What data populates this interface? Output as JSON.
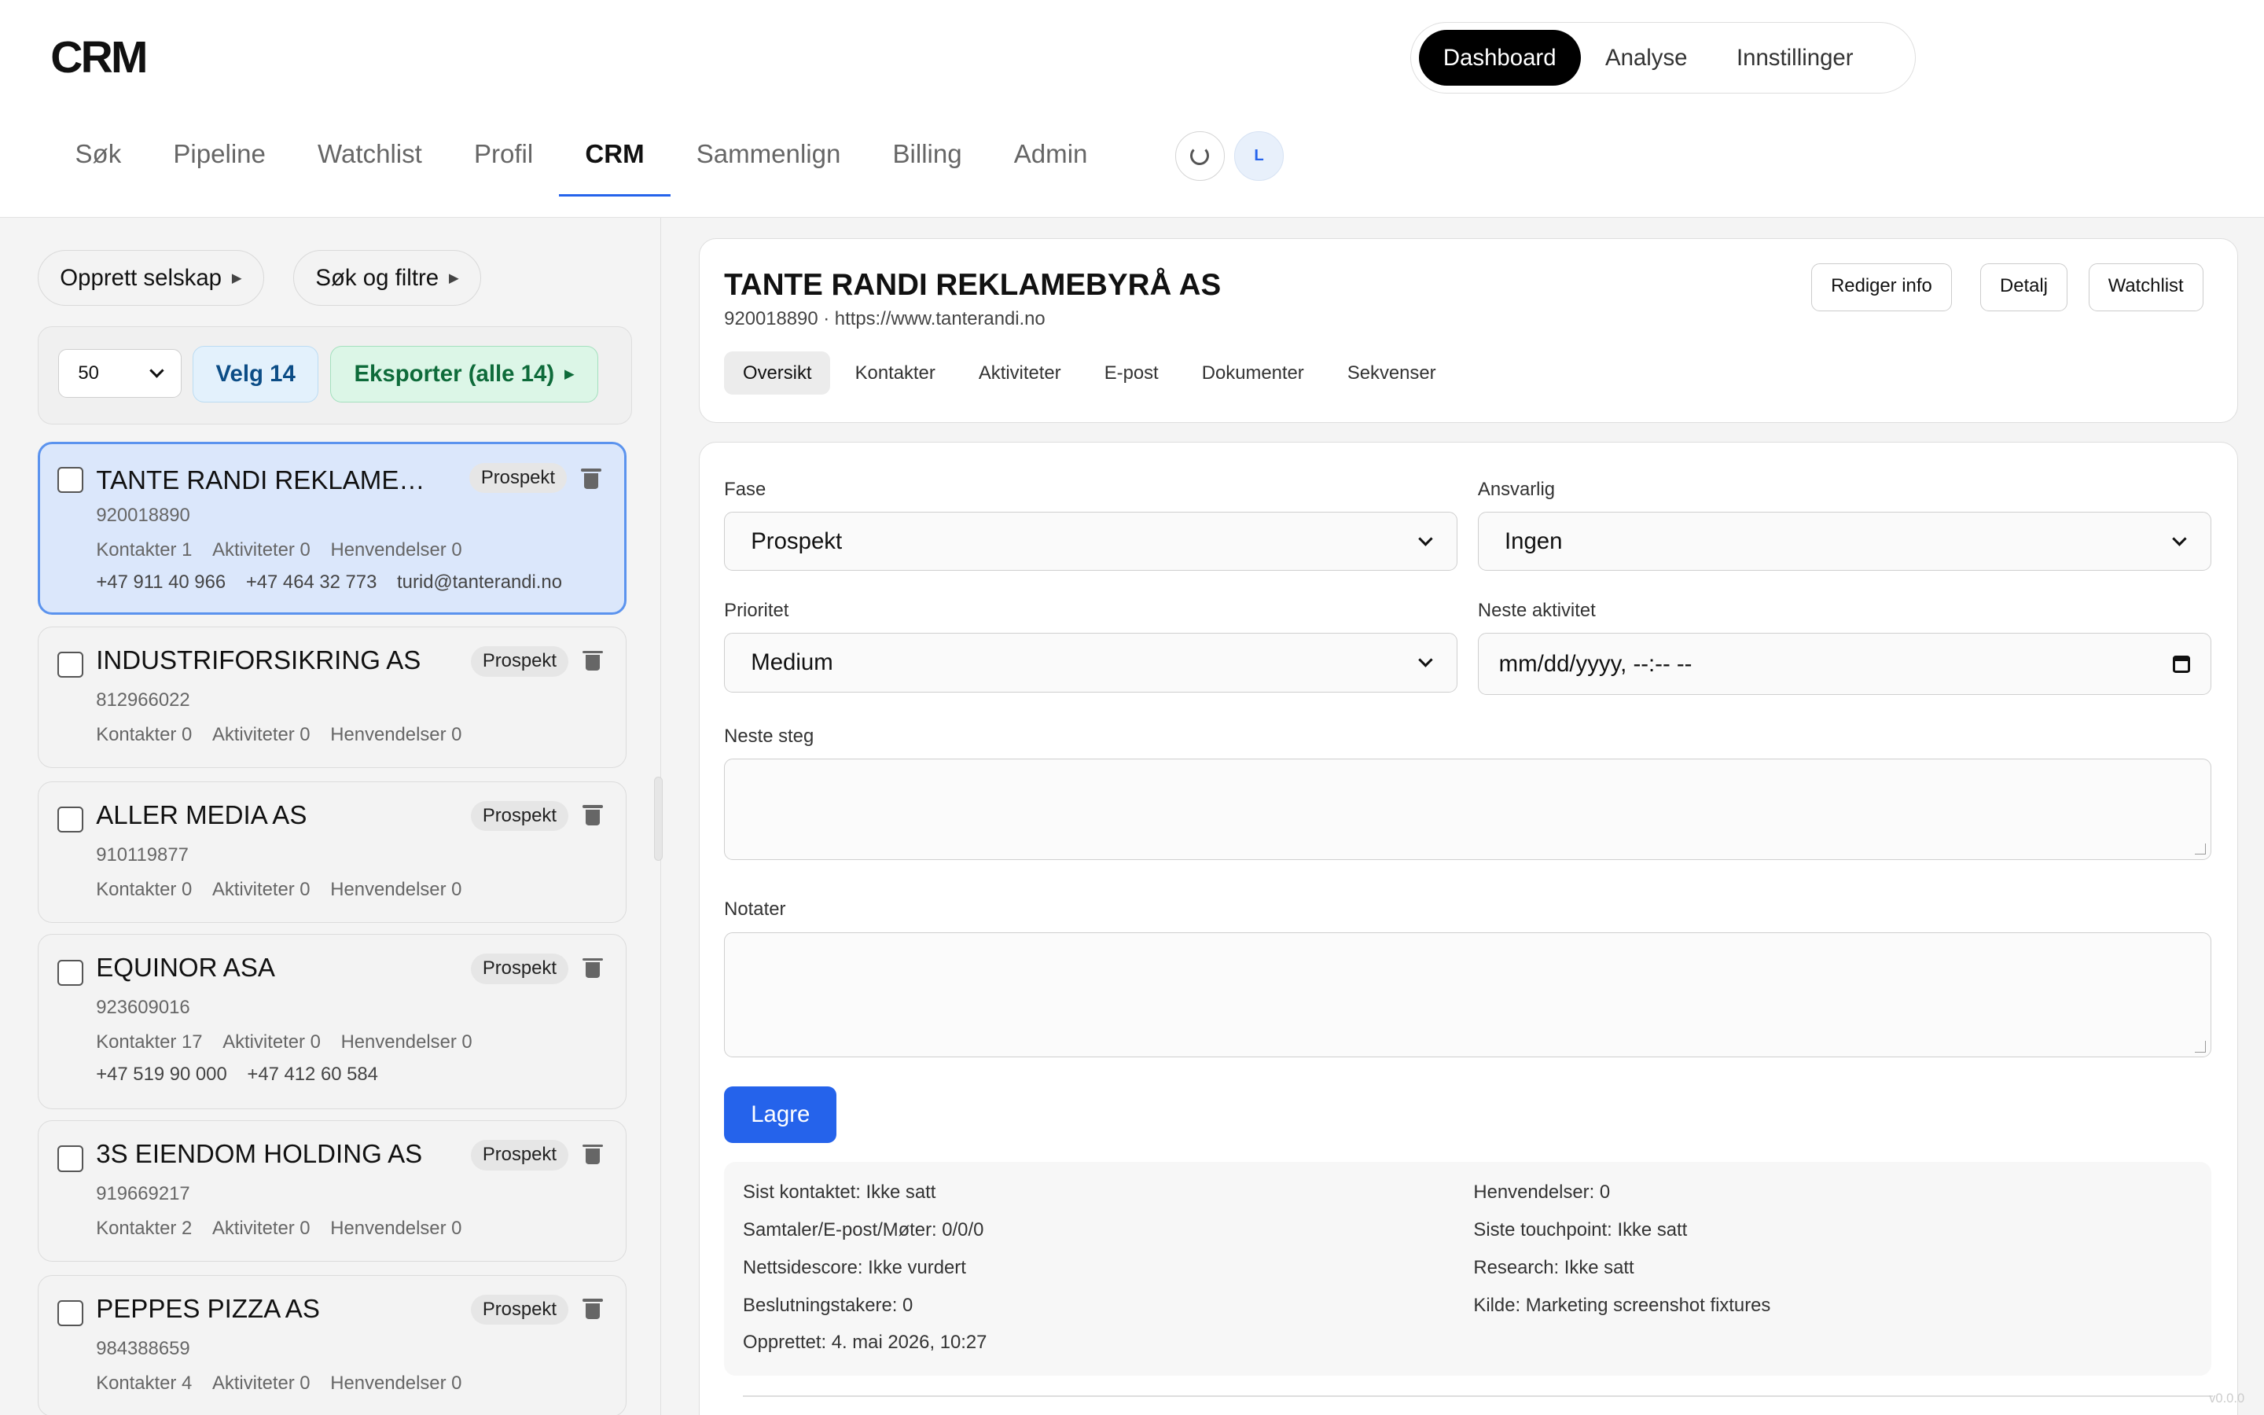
{
  "app": {
    "logo": "CRM"
  },
  "top_segments": [
    "Dashboard",
    "Analyse",
    "Innstillinger"
  ],
  "nav_tabs": [
    "Søk",
    "Pipeline",
    "Watchlist",
    "Profil",
    "CRM",
    "Sammenlign",
    "Billing",
    "Admin"
  ],
  "nav_active": "CRM",
  "avatar_initial": "L",
  "left": {
    "create_label": "Opprett selskap",
    "search_label": "Søk og filtre",
    "page_size": "50",
    "select_label": "Velg 14",
    "export_label": "Eksporter (alle 14)"
  },
  "companies": [
    {
      "name": "TANTE RANDI REKLAMEBYRÅ AS",
      "display_name": "TANTE RANDI REKLAMEB...",
      "orgnr": "920018890",
      "status": "Prospekt",
      "kontakter": "Kontakter 1",
      "aktiviteter": "Aktiviteter 0",
      "henvendelser": "Henvendelser 0",
      "phones": [
        "+47 911 40 966",
        "+47 464 32 773",
        "turid@tanterandi.no"
      ],
      "selected": true
    },
    {
      "name": "INDUSTRIFORSIKRING AS",
      "display_name": "INDUSTRIFORSIKRING AS",
      "orgnr": "812966022",
      "status": "Prospekt",
      "kontakter": "Kontakter 0",
      "aktiviteter": "Aktiviteter 0",
      "henvendelser": "Henvendelser 0",
      "phones": []
    },
    {
      "name": "ALLER MEDIA AS",
      "display_name": "ALLER MEDIA AS",
      "orgnr": "910119877",
      "status": "Prospekt",
      "kontakter": "Kontakter 0",
      "aktiviteter": "Aktiviteter 0",
      "henvendelser": "Henvendelser 0",
      "phones": []
    },
    {
      "name": "EQUINOR ASA",
      "display_name": "EQUINOR ASA",
      "orgnr": "923609016",
      "status": "Prospekt",
      "kontakter": "Kontakter 17",
      "aktiviteter": "Aktiviteter 0",
      "henvendelser": "Henvendelser 0",
      "phones": [
        "+47 519 90 000",
        "+47 412 60 584"
      ]
    },
    {
      "name": "3S EIENDOM HOLDING AS",
      "display_name": "3S EIENDOM HOLDING AS",
      "orgnr": "919669217",
      "status": "Prospekt",
      "kontakter": "Kontakter 2",
      "aktiviteter": "Aktiviteter 0",
      "henvendelser": "Henvendelser 0",
      "phones": []
    },
    {
      "name": "PEPPES PIZZA AS",
      "display_name": "PEPPES PIZZA AS",
      "orgnr": "984388659",
      "status": "Prospekt",
      "kontakter": "Kontakter 4",
      "aktiviteter": "Aktiviteter 0",
      "henvendelser": "Henvendelser 0",
      "phones": []
    }
  ],
  "detail": {
    "title": "TANTE RANDI REKLAMEBYRÅ AS",
    "subtitle": "920018890 · https://www.tanterandi.no",
    "buttons": [
      "Rediger info",
      "Detalj",
      "Watchlist"
    ],
    "tabs": [
      "Oversikt",
      "Kontakter",
      "Aktiviteter",
      "E-post",
      "Dokumenter",
      "Sekvenser"
    ],
    "active_tab": "Oversikt"
  },
  "form": {
    "fase_label": "Fase",
    "fase_value": "Prospekt",
    "ansvarlig_label": "Ansvarlig",
    "ansvarlig_value": "Ingen",
    "prioritet_label": "Prioritet",
    "prioritet_value": "Medium",
    "neste_aktivitet_label": "Neste aktivitet",
    "neste_aktivitet_value": "mm/dd/yyyy, --:-- --",
    "neste_steg_label": "Neste steg",
    "notater_label": "Notater",
    "save_label": "Lagre"
  },
  "meta": {
    "left": [
      "Sist kontaktet: Ikke satt",
      "Samtaler/E-post/Møter: 0/0/0",
      "Nettsidescore: Ikke vurdert",
      "Beslutningstakere: 0",
      "Opprettet: 4. mai 2026, 10:27"
    ],
    "right": [
      "Henvendelser: 0",
      "Siste touchpoint: Ikke satt",
      "Research: Ikke satt",
      "Kilde: Marketing screenshot fixtures"
    ]
  },
  "version": "v0.0.0"
}
